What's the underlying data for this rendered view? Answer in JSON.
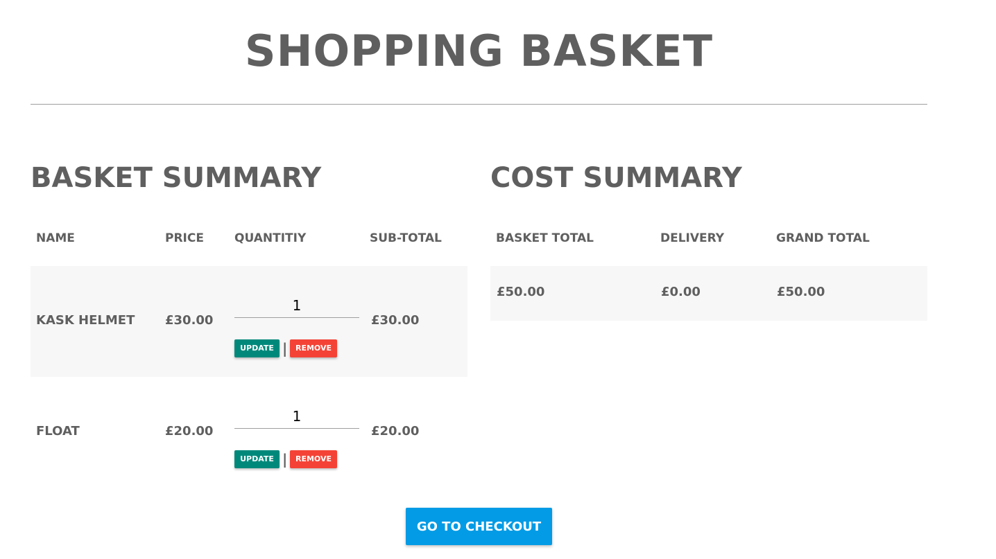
{
  "page": {
    "title": "Shopping Basket"
  },
  "basket_summary": {
    "heading": "Basket Summary",
    "columns": [
      "Name",
      "Price",
      "Quantitiy",
      "Sub-Total"
    ],
    "items": [
      {
        "name": "Kask Helmet",
        "price": "£30.00",
        "quantity": "1",
        "subtotal": "£30.00",
        "update_label": "Update",
        "separator": "|",
        "remove_label": "Remove"
      },
      {
        "name": "Float",
        "price": "£20.00",
        "quantity": "1",
        "subtotal": "£20.00",
        "update_label": "Update",
        "separator": "|",
        "remove_label": "Remove"
      }
    ]
  },
  "cost_summary": {
    "heading": "Cost Summary",
    "columns": [
      "Basket Total",
      "Delivery",
      "Grand Total"
    ],
    "values": [
      "£50.00",
      "£0.00",
      "£50.00"
    ]
  },
  "checkout": {
    "label": "Go to Checkout"
  },
  "colors": {
    "text": "#5f5f5f",
    "update_button": "#00897b",
    "remove_button": "#f44336",
    "checkout_button": "#039be5",
    "striped_row": "#f7f7f7"
  }
}
